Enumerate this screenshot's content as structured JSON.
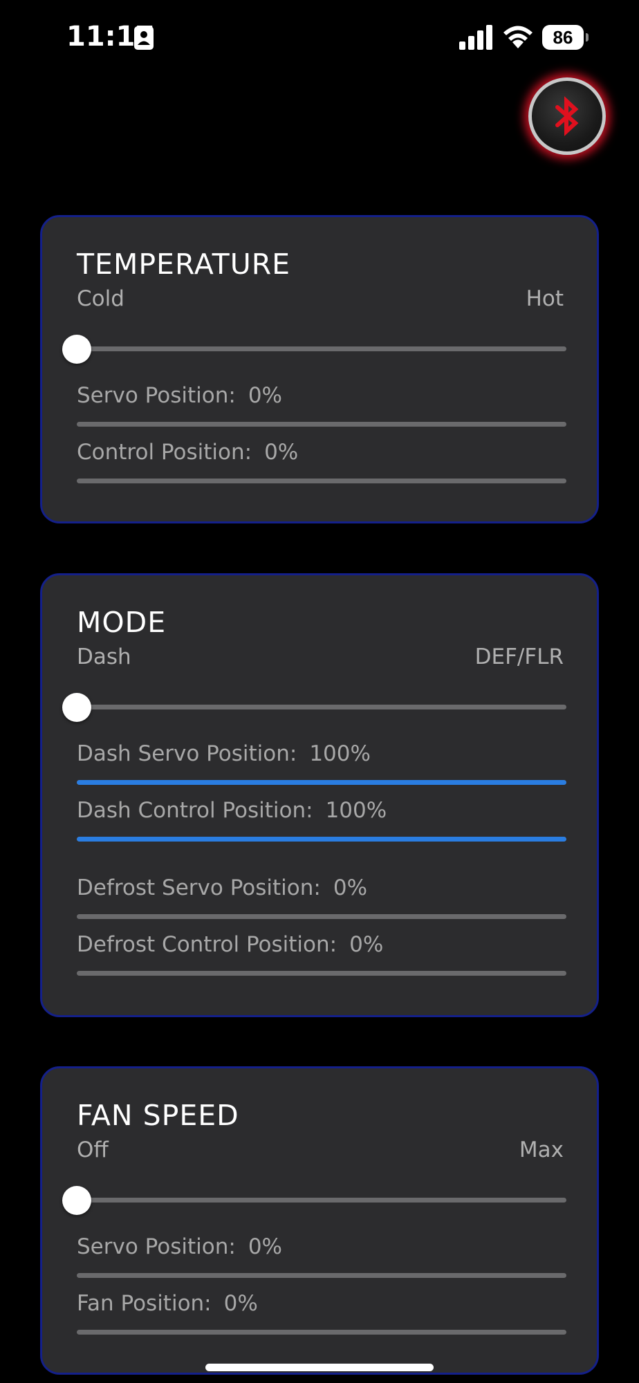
{
  "status_bar": {
    "time": "11:17",
    "battery": "86",
    "icons": [
      "contact-card-icon",
      "cellular-signal-icon",
      "wifi-icon",
      "battery-icon"
    ]
  },
  "bluetooth": {
    "icon": "bluetooth-icon",
    "glow_color": "#e6142a"
  },
  "colors": {
    "card_bg": "#2c2c2e",
    "card_border": "#14208a",
    "accent": "#2a7de1",
    "track": "#6a6a6c"
  },
  "temperature": {
    "title": "TEMPERATURE",
    "min_label": "Cold",
    "max_label": "Hot",
    "slider_value": 0,
    "readouts": [
      {
        "label": "Servo Position:",
        "value": "0%",
        "fill": 0
      },
      {
        "label": "Control Position:",
        "value": "0%",
        "fill": 0
      }
    ]
  },
  "mode": {
    "title": "MODE",
    "min_label": "Dash",
    "max_label": "DEF/FLR",
    "slider_value": 0,
    "readouts": [
      {
        "label": "Dash Servo Position:",
        "value": "100%",
        "fill": 100
      },
      {
        "label": "Dash Control Position:",
        "value": "100%",
        "fill": 100
      },
      {
        "label": "Defrost Servo Position:",
        "value": "0%",
        "fill": 0
      },
      {
        "label": "Defrost Control Position:",
        "value": "0%",
        "fill": 0
      }
    ]
  },
  "fan_speed": {
    "title": "FAN SPEED",
    "min_label": "Off",
    "max_label": "Max",
    "slider_value": 0,
    "readouts": [
      {
        "label": "Servo Position:",
        "value": "0%",
        "fill": 0
      },
      {
        "label": "Fan Position:",
        "value": "0%",
        "fill": 0
      }
    ]
  }
}
